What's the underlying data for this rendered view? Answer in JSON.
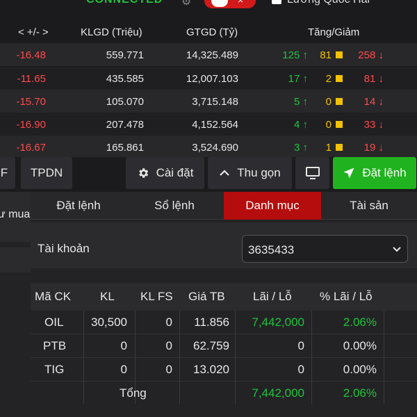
{
  "topbar": {
    "status": "CONNECTED",
    "toggle_x": "×",
    "checkbox_label": "Lương Quốc Hải"
  },
  "market": {
    "headers": {
      "change": "< +/- >",
      "volume": "KLGD (Triệu)",
      "value": "GTGD (Tỷ)",
      "breadth": "Tăng/Giảm"
    },
    "rows": [
      {
        "change": "-16.48",
        "volume": "559.771",
        "value": "14,325.489",
        "up": "125",
        "same": "81",
        "down": "258"
      },
      {
        "change": "-11.65",
        "volume": "435.585",
        "value": "12,007.103",
        "up": "17",
        "same": "2",
        "down": "81"
      },
      {
        "change": "-15.70",
        "volume": "105.070",
        "value": "3,715.148",
        "up": "5",
        "same": "0",
        "down": "14"
      },
      {
        "change": "-16.90",
        "volume": "207.478",
        "value": "4,152.564",
        "up": "4",
        "same": "0",
        "down": "33"
      },
      {
        "change": "-16.67",
        "volume": "165.861",
        "value": "3,524.690",
        "up": "3",
        "same": "1",
        "down": "19"
      }
    ],
    "up_arrow": "↑",
    "down_arrow": "↓"
  },
  "buttons": {
    "f_tab": "F",
    "tpdn": "TPDN",
    "settings": "Cài đặt",
    "collapse": "Thu gọn",
    "place_order": "Đặt lệnh"
  },
  "left_panel": {
    "tab_label": "ư mua"
  },
  "order_panel": {
    "tabs": [
      "Đặt lệnh",
      "Sổ lệnh",
      "Danh mục",
      "Tài sản"
    ],
    "active_tab": "Danh mục",
    "account_label": "Tài khoản",
    "account_value": "3635433",
    "portfolio": {
      "headers": [
        "Mã CK",
        "KL",
        "KL FS",
        "Giá TB",
        "Lãi / Lỗ",
        "% Lãi / Lỗ"
      ],
      "rows": [
        {
          "symbol": "OIL",
          "qty": "30,500",
          "qty_fs": "0",
          "avg_price": "11.856",
          "pnl": "7,442,000",
          "pnl_pct": "2.06%"
        },
        {
          "symbol": "PTB",
          "qty": "0",
          "qty_fs": "0",
          "avg_price": "62.759",
          "pnl": "0",
          "pnl_pct": "0.00%"
        },
        {
          "symbol": "TIG",
          "qty": "0",
          "qty_fs": "0",
          "avg_price": "13.020",
          "pnl": "0",
          "pnl_pct": "0.00%"
        }
      ],
      "total_label": "Tổng",
      "total_pnl": "7,442,000",
      "total_pnl_pct": "2.06%"
    }
  },
  "colors": {
    "up": "#1ec43a",
    "same": "#f2c200",
    "down": "#ff4a4a",
    "active_tab": "#b50d0d",
    "order_button": "#20b31f"
  },
  "icons": {
    "settings": "gear-icon",
    "collapse": "chevron-up-icon",
    "display": "monitor-icon",
    "order": "send-icon",
    "account_select": "chevron-down-icon"
  }
}
